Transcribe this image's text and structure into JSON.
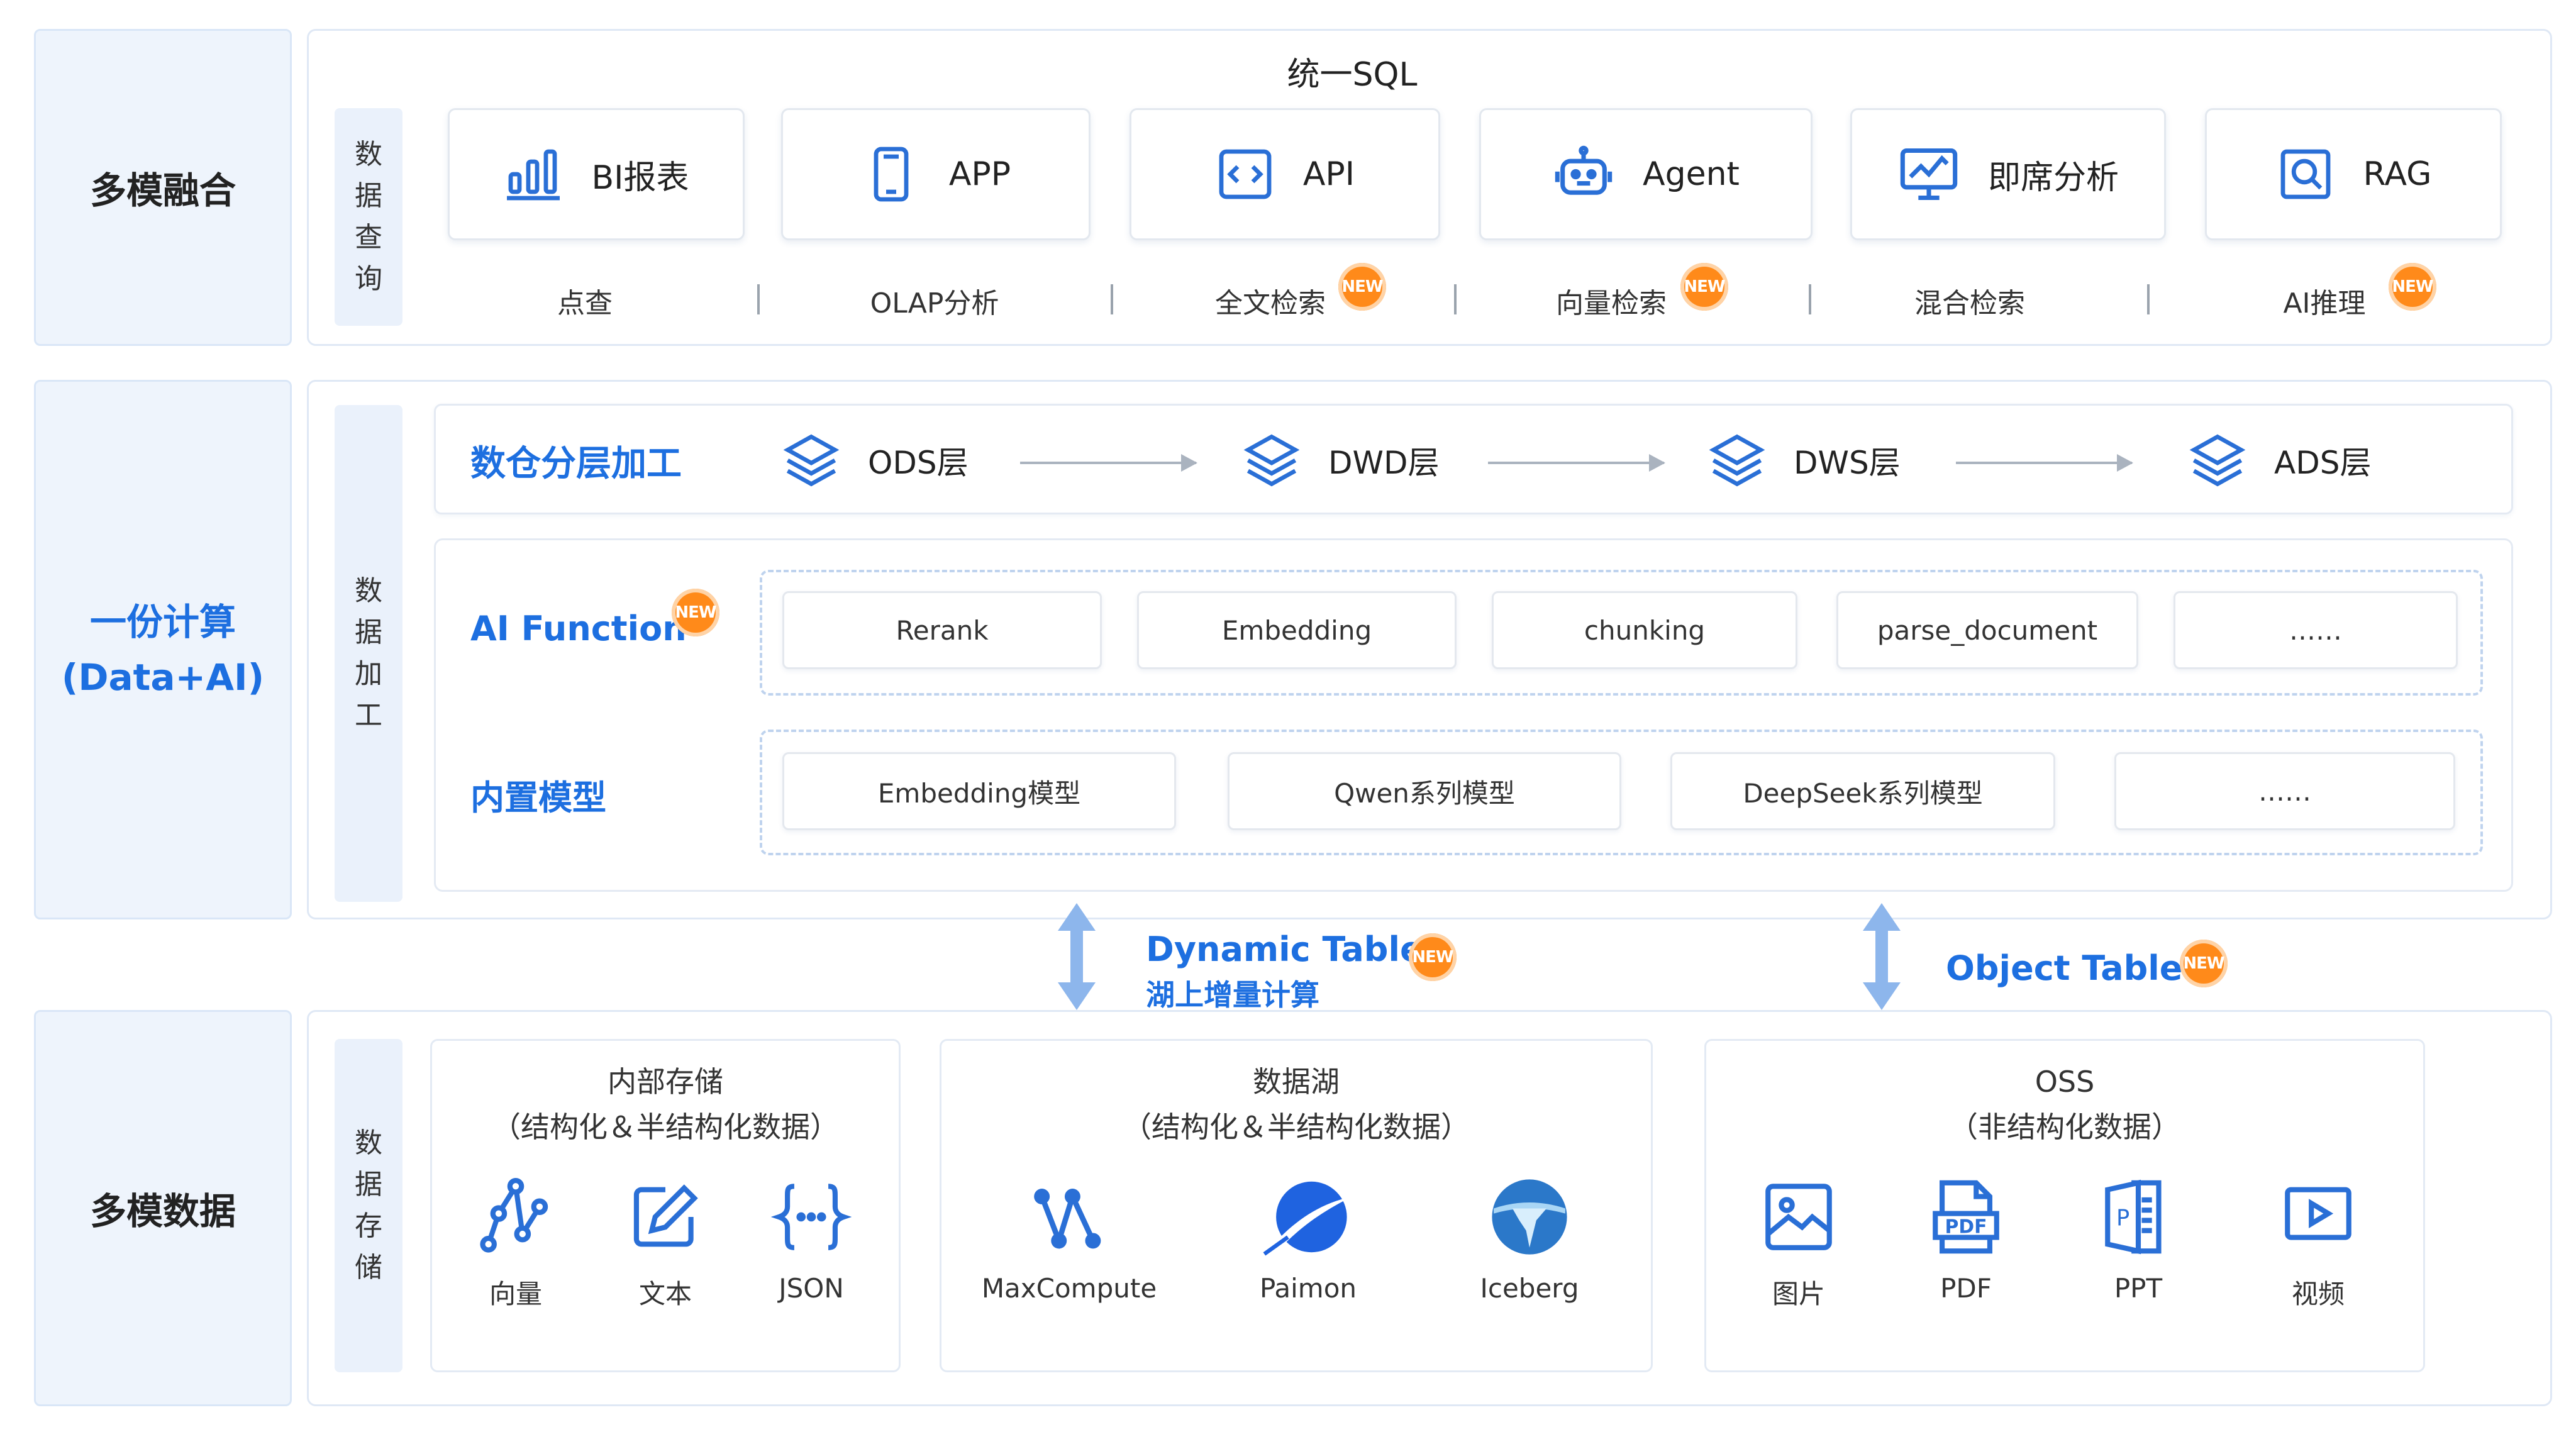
{
  "rows": {
    "fusion": "多模融合",
    "compute_line1": "一份计算",
    "compute_line2": "(Data+AI)",
    "data": "多模数据"
  },
  "query": {
    "vertical": [
      "数",
      "据",
      "查",
      "询"
    ],
    "sql_title": "统一SQL",
    "cards": [
      {
        "label": "BI报表",
        "icon": "bar-chart-icon"
      },
      {
        "label": "APP",
        "icon": "phone-icon"
      },
      {
        "label": "API",
        "icon": "code-icon"
      },
      {
        "label": "Agent",
        "icon": "robot-icon"
      },
      {
        "label": "即席分析",
        "icon": "monitor-chart-icon"
      },
      {
        "label": "RAG",
        "icon": "search-doc-icon"
      }
    ],
    "labels": [
      "点查",
      "OLAP分析",
      "全文检索",
      "向量检索",
      "混合检索",
      "AI推理"
    ]
  },
  "badge": "NEW",
  "processing": {
    "vertical": [
      "数",
      "据",
      "加",
      "工"
    ],
    "layers_title": "数仓分层加工",
    "layers": [
      "ODS层",
      "DWD层",
      "DWS层",
      "ADS层"
    ],
    "ai_function_title": "AI Function",
    "functions": [
      "Rerank",
      "Embedding",
      "chunking",
      "parse_document",
      "……"
    ],
    "builtin_title": "内置模型",
    "models": [
      "Embedding模型",
      "Qwen系列模型",
      "DeepSeek系列模型",
      "……"
    ]
  },
  "connectors": {
    "dynamic_title": "Dynamic Table",
    "dynamic_sub": "湖上增量计算",
    "object_title": "Object Table"
  },
  "storage": {
    "vertical": [
      "数",
      "据",
      "存",
      "储"
    ],
    "internal": {
      "title": "内部存储",
      "subtitle": "（结构化＆半结构化数据）",
      "items": [
        {
          "label": "向量",
          "icon": "vector-icon"
        },
        {
          "label": "文本",
          "icon": "edit-doc-icon"
        },
        {
          "label": "JSON",
          "icon": "json-braces-icon"
        }
      ]
    },
    "lake": {
      "title": "数据湖",
      "subtitle": "（结构化＆半结构化数据）",
      "items": [
        {
          "label": "MaxCompute",
          "icon": "maxcompute-logo-icon"
        },
        {
          "label": "Paimon",
          "icon": "paimon-logo-icon"
        },
        {
          "label": "Iceberg",
          "icon": "iceberg-logo-icon"
        }
      ]
    },
    "oss": {
      "title": "OSS",
      "subtitle": "（非结构化数据）",
      "items": [
        {
          "label": "图片",
          "icon": "image-icon"
        },
        {
          "label": "PDF",
          "icon": "pdf-icon"
        },
        {
          "label": "PPT",
          "icon": "ppt-icon"
        },
        {
          "label": "视频",
          "icon": "video-icon"
        }
      ]
    }
  },
  "colors": {
    "accent": "#1d6fe0",
    "badge": "#ff8a1a",
    "side_bg": "#eef4fc",
    "icon_blue": "#2a6fd6"
  }
}
